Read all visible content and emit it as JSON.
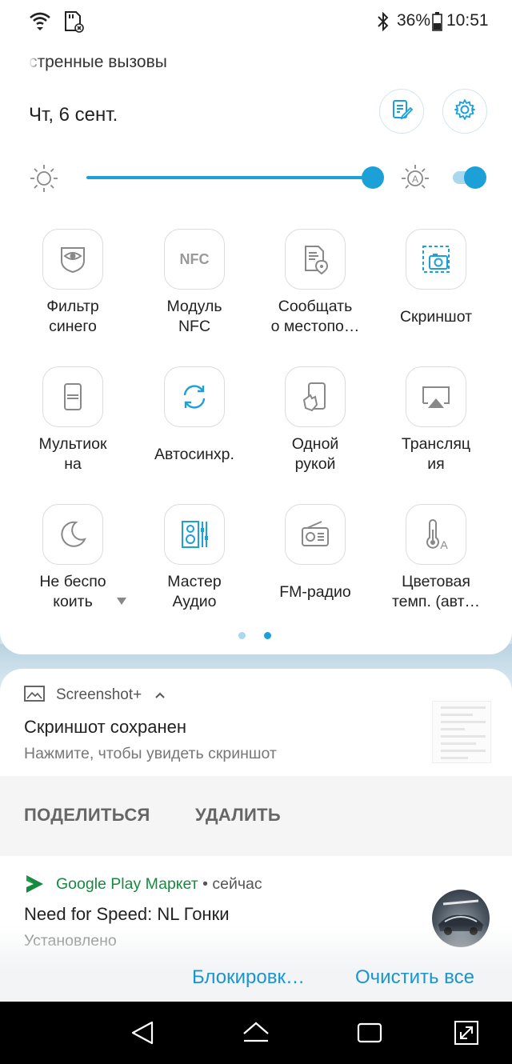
{
  "status_bar": {
    "battery_percent": "36%",
    "time": "10:51",
    "icons": [
      "wifi-icon",
      "sd-card-icon",
      "bluetooth-icon",
      "battery-icon"
    ]
  },
  "quick_settings": {
    "carrier_text": "стренные вызовы",
    "date": "Чт, 6 сент.",
    "brightness_level": 1.0,
    "auto_brightness_on": true,
    "tiles": [
      {
        "label": "Фильтр\nсинего",
        "icon": "blue-filter-icon"
      },
      {
        "label": "Модуль\nNFC",
        "icon": "nfc-icon",
        "icon_text": "NFC"
      },
      {
        "label": "Сообщать\nо местопо…",
        "icon": "location-report-icon"
      },
      {
        "label": "Скриншот",
        "icon": "screenshot-icon"
      },
      {
        "label": "Мультиок\nна",
        "icon": "multiwindow-icon"
      },
      {
        "label": "Автосинхр.",
        "icon": "autosync-icon"
      },
      {
        "label": "Одной\nрукой",
        "icon": "one-hand-icon"
      },
      {
        "label": "Трансляц\nия",
        "icon": "cast-icon"
      },
      {
        "label": "Не беспо\nкоить",
        "icon": "do-not-disturb-icon"
      },
      {
        "label": "Мастер\nАудио",
        "icon": "audio-wizard-icon"
      },
      {
        "label": "FM-радио",
        "icon": "fm-radio-icon"
      },
      {
        "label": "Цветовая\nтемп. (авт…",
        "icon": "color-temperature-icon"
      }
    ],
    "page_count": 2,
    "active_page": 2,
    "accent_color": "#1ba1d8"
  },
  "notifications": {
    "screenshot": {
      "app_name": "Screenshot+",
      "title": "Скриншот сохранен",
      "subtitle": "Нажмите, чтобы увидеть скриншот",
      "share_label": "ПОДЕЛИТЬСЯ",
      "delete_label": "УДАЛИТЬ"
    },
    "play_store": {
      "app_name": "Google Play Маркет",
      "time": "• сейчас",
      "title": "Need for Speed: NL Гонки",
      "subtitle": "Установлено",
      "app_color": "#178a3f"
    },
    "block_label": "Блокировк…",
    "clear_all_label": "Очистить все"
  }
}
